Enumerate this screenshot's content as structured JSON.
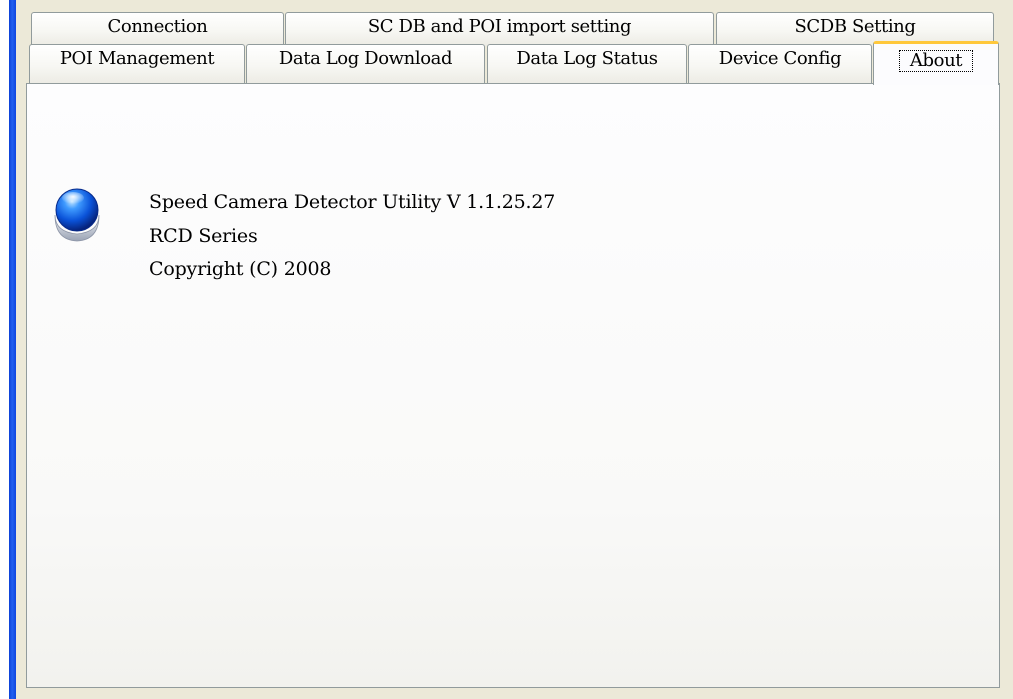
{
  "tabs": {
    "row1": [
      {
        "label": "Connection"
      },
      {
        "label": "SC DB and POI import setting"
      },
      {
        "label": "SCDB  Setting"
      }
    ],
    "row2": [
      {
        "label": "POI Management"
      },
      {
        "label": "Data Log Download"
      },
      {
        "label": "Data Log Status"
      },
      {
        "label": "Device Config"
      },
      {
        "label": "About",
        "selected": true
      }
    ]
  },
  "about": {
    "icon": "blue-orb-icon",
    "product_line": "Speed Camera Detector Utility  V 1.1.25.27",
    "series_line": "RCD Series",
    "copyright_line": "Copyright (C) 2008"
  },
  "colors": {
    "window_border_blue": "#0f47df",
    "active_tab_highlight": "#ffc83c",
    "tab_border": "#919b9c",
    "dialog_background": "#ece9d8"
  }
}
